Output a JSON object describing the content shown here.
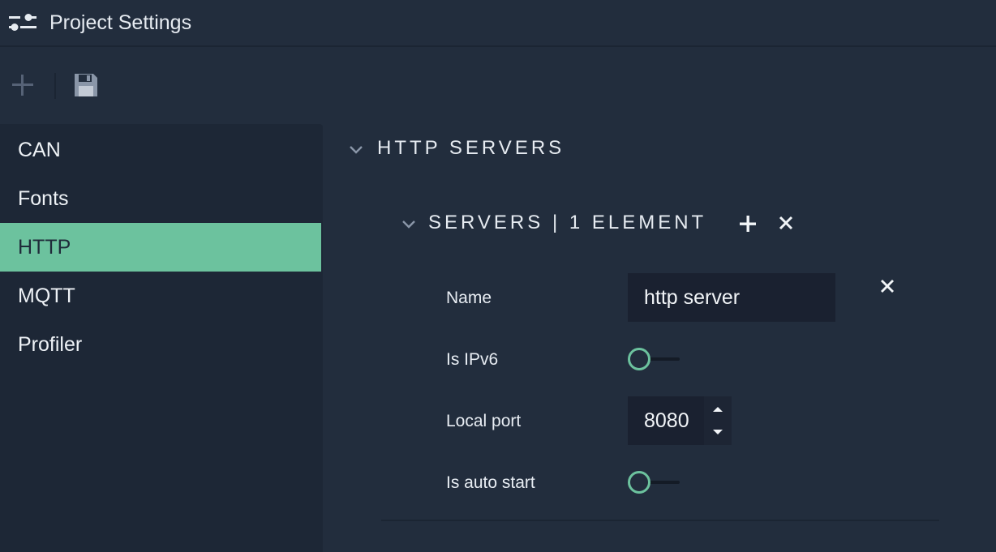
{
  "window": {
    "title": "Project Settings",
    "title_icon": "sliders-icon"
  },
  "toolbar": {
    "add_icon": "plus-icon",
    "save_icon": "floppy-disk-icon"
  },
  "sidebar": {
    "items": [
      {
        "label": "CAN",
        "active": false
      },
      {
        "label": "Fonts",
        "active": false
      },
      {
        "label": "HTTP",
        "active": true
      },
      {
        "label": "MQTT",
        "active": false
      },
      {
        "label": "Profiler",
        "active": false
      }
    ]
  },
  "section": {
    "title": "HTTP SERVERS",
    "subsection": {
      "title": "SERVERS | 1 ELEMENT",
      "fields": {
        "name": {
          "label": "Name",
          "value": "http server"
        },
        "is_ipv6": {
          "label": "Is IPv6",
          "checked": false
        },
        "local_port": {
          "label": "Local port",
          "value": "8080"
        },
        "is_auto_start": {
          "label": "Is auto start",
          "checked": false
        }
      }
    }
  },
  "colors": {
    "accent": "#6cc29e",
    "background": "#222d3d",
    "sidebar": "#1d2736",
    "input": "#1a2130"
  }
}
